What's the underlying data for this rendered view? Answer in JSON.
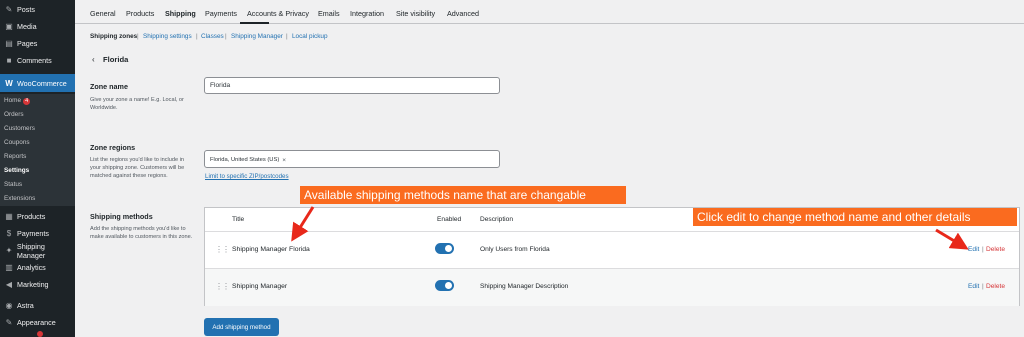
{
  "sidebar": {
    "items": [
      {
        "label": "Posts",
        "icon": "pin-icon"
      },
      {
        "label": "Media",
        "icon": "media-icon"
      },
      {
        "label": "Pages",
        "icon": "pages-icon"
      },
      {
        "label": "Comments",
        "icon": "comments-icon"
      },
      {
        "label": "WooCommerce",
        "icon": "woo-icon"
      },
      {
        "label": "Products",
        "icon": "products-icon"
      },
      {
        "label": "Payments",
        "icon": "payments-icon"
      },
      {
        "label": "Shipping Manager",
        "icon": "shipping-icon"
      },
      {
        "label": "Analytics",
        "icon": "analytics-icon"
      },
      {
        "label": "Marketing",
        "icon": "marketing-icon"
      },
      {
        "label": "Astra",
        "icon": "astra-icon"
      },
      {
        "label": "Appearance",
        "icon": "appearance-icon"
      }
    ],
    "submenu": {
      "home": "Home",
      "home_badge": "4",
      "orders": "Orders",
      "customers": "Customers",
      "coupons": "Coupons",
      "reports": "Reports",
      "settings": "Settings",
      "status": "Status",
      "extensions": "Extensions"
    }
  },
  "tabs": [
    "General",
    "Products",
    "Shipping",
    "Payments",
    "Accounts & Privacy",
    "Emails",
    "Integration",
    "Site visibility",
    "Advanced"
  ],
  "sublinks": [
    "Shipping zones",
    "Shipping settings",
    "Classes",
    "Shipping Manager",
    "Local pickup"
  ],
  "sublink_separator": "|",
  "zone_heading": "Florida",
  "zone_name": {
    "label": "Zone name",
    "help": "Give your zone a name! E.g. Local, or Worldwide.",
    "value": "Florida"
  },
  "zone_regions": {
    "label": "Zone regions",
    "help": "List the regions you'd like to include in your shipping zone. Customers will be matched against these regions.",
    "chip": "Florida, United States (US)",
    "chip_remove": "×",
    "zip_link": "Limit to specific ZIP/postcodes"
  },
  "shipping_methods": {
    "label": "Shipping methods",
    "help": "Add the shipping methods you'd like to make available to customers in this zone.",
    "columns": {
      "title": "Title",
      "enabled": "Enabled",
      "description": "Description"
    },
    "rows": [
      {
        "title": "Shipping Manager Florida",
        "enabled": true,
        "description": "Only Users from Florida",
        "edit": "Edit",
        "delete": "Delete"
      },
      {
        "title": "Shipping Manager",
        "enabled": true,
        "description": "Shipping Manager Description",
        "edit": "Edit",
        "delete": "Delete"
      }
    ],
    "add_button": "Add shipping method"
  },
  "annotations": {
    "callout_1": "Available shipping methods name that are changable",
    "callout_2": "Click edit to change method name and other details",
    "color": "#fa6b1f"
  },
  "colors": {
    "accent": "#2271b1",
    "sidebar": "#1d2327",
    "danger": "#d63638"
  }
}
